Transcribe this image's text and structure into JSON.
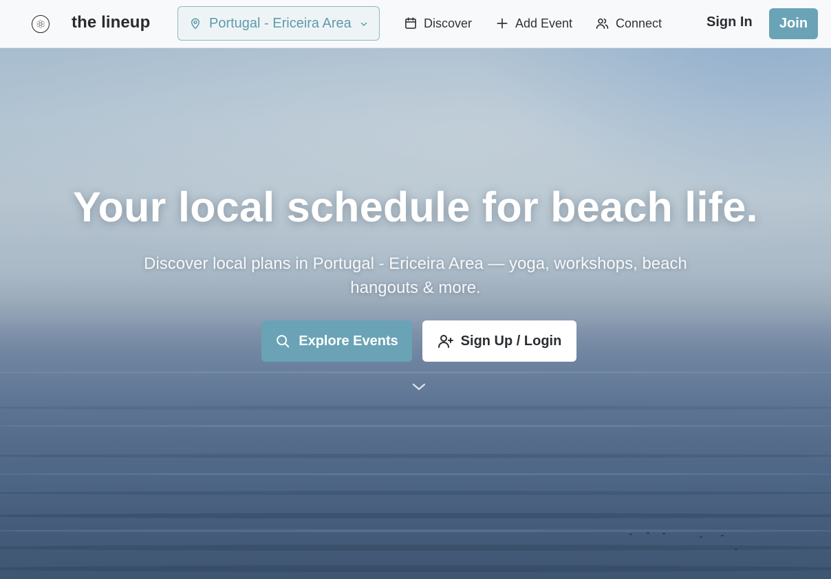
{
  "header": {
    "brand": "the lineup",
    "location": {
      "label": "Portugal - Ericeira Area",
      "icon": "map-pin-icon"
    },
    "nav": [
      {
        "label": "Discover",
        "icon": "calendar-icon"
      },
      {
        "label": "Add Event",
        "icon": "plus-icon"
      },
      {
        "label": "Connect",
        "icon": "users-icon"
      }
    ],
    "sign_in": "Sign In",
    "join": "Join"
  },
  "hero": {
    "headline": "Your local schedule for beach life.",
    "subline": "Discover local plans in Portugal - Ericeira Area — yoga, workshops, beach hangouts & more.",
    "explore_button": "Explore Events",
    "signup_button": "Sign Up / Login"
  },
  "colors": {
    "accent": "#6aa3b5",
    "header_bg": "#f8f9fb",
    "text_dark": "#2a2d31"
  }
}
